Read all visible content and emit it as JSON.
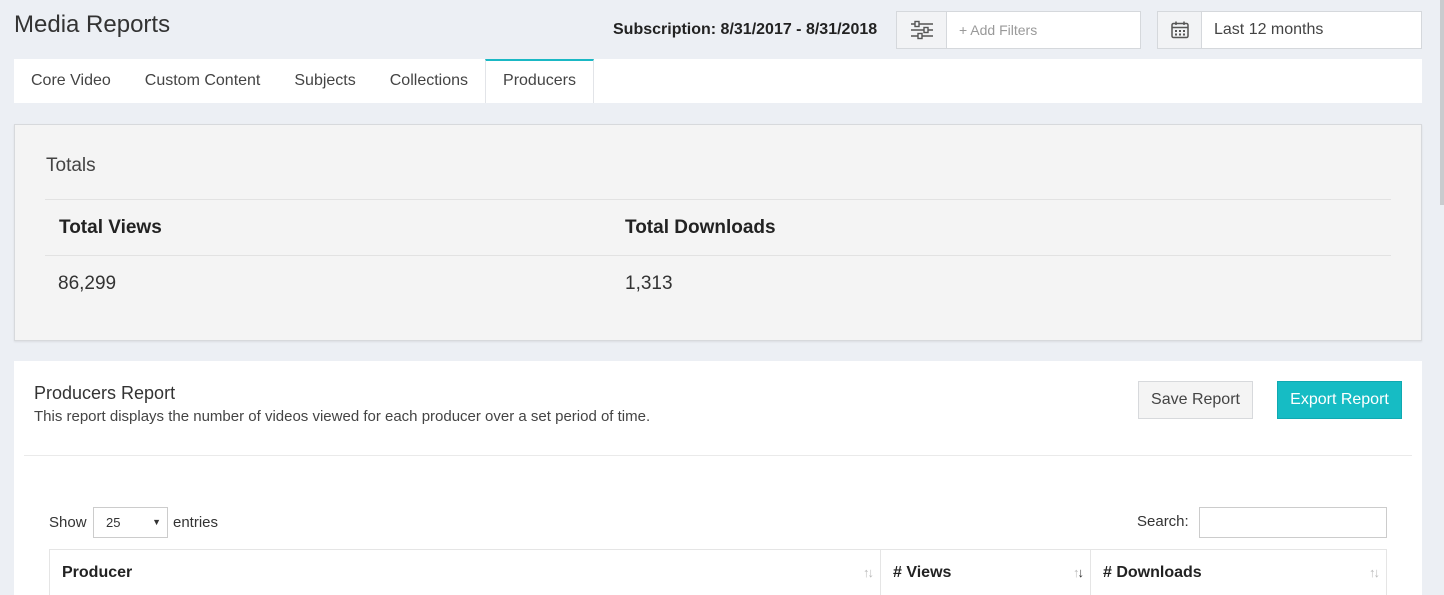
{
  "header": {
    "title": "Media Reports",
    "subscription": "Subscription: 8/31/2017 - 8/31/2018",
    "filter_placeholder": "+ Add Filters",
    "date_range": "Last 12 months"
  },
  "tabs": [
    {
      "label": "Core Video"
    },
    {
      "label": "Custom Content"
    },
    {
      "label": "Subjects"
    },
    {
      "label": "Collections"
    },
    {
      "label": "Producers"
    }
  ],
  "active_tab": "Producers",
  "totals": {
    "title": "Totals",
    "views_label": "Total Views",
    "downloads_label": "Total Downloads",
    "views_value": "86,299",
    "downloads_value": "1,313"
  },
  "report": {
    "title": "Producers Report",
    "description": "This report displays the number of videos viewed for each producer over a set period of time.",
    "save_label": "Save Report",
    "export_label": "Export Report",
    "show_label": "Show",
    "entries_value": "25",
    "entries_label": "entries",
    "search_label": "Search:",
    "columns": [
      {
        "label": "Producer"
      },
      {
        "label": "# Views"
      },
      {
        "label": "# Downloads"
      }
    ]
  },
  "colors": {
    "accent": "#16bcc4",
    "background": "#eceff4"
  },
  "icons": {
    "filter": "sliders-icon",
    "date": "calendar-icon",
    "sort": "sort-arrows-icon"
  }
}
